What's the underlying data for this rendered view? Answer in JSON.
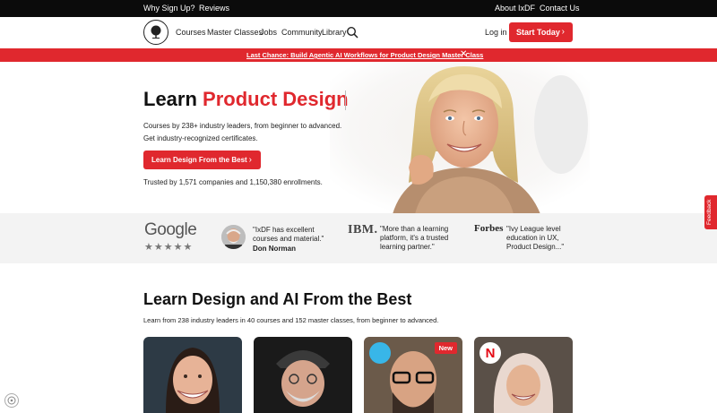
{
  "topbar": {
    "left_links": [
      "Why Sign Up?",
      "Reviews"
    ],
    "right_links": [
      "About IxDF",
      "Contact Us"
    ]
  },
  "nav": {
    "logo_icon": "tree-logo-icon",
    "links": [
      "Courses",
      "Master Classes",
      "Jobs",
      "Community",
      "Library"
    ],
    "search_icon": "search-icon",
    "login_label": "Log in",
    "start_label": "Start Today"
  },
  "promo": {
    "text": "Last Chance: Build Agentic AI Workflows for Product Design Master Class",
    "close_icon": "close-icon"
  },
  "hero": {
    "title_prefix": "Learn ",
    "title_accent": "Product Design",
    "sub_line1": "Courses by 238+ industry leaders, from beginner to advanced.",
    "sub_line2": "Get industry-recognized certificates.",
    "cta_label": "Learn Design From the Best",
    "trusted": "Trusted by 1,571 companies and 1,150,380 enrollments."
  },
  "testimonials": {
    "google_logo": "Google",
    "stars": "★★★★★",
    "norman_quote_line1": "\"IxDF has excellent",
    "norman_quote_line2": "courses and material.\"",
    "norman_name": "Don Norman",
    "ibm_logo": "IBM.",
    "ibm_quote_line1": "\"More than a learning",
    "ibm_quote_line2": "platform, it's a trusted",
    "ibm_quote_line3": "learning partner.\"",
    "forbes_logo": "Forbes",
    "forbes_quote_line1": "\"Ivy League level",
    "forbes_quote_line2": "education in UX,",
    "forbes_quote_line3": "Product Design...\""
  },
  "section": {
    "title": "Learn Design and AI From the Best",
    "subtitle": "Learn from 238 industry leaders in 40 courses and 152 master classes, from beginner to advanced."
  },
  "cards": {
    "new_badge": "New",
    "netflix_letter": "N"
  },
  "feedback_label": "Feedback",
  "colors": {
    "brand_red": "#e0282e",
    "topbar": "#0b0b0b"
  }
}
